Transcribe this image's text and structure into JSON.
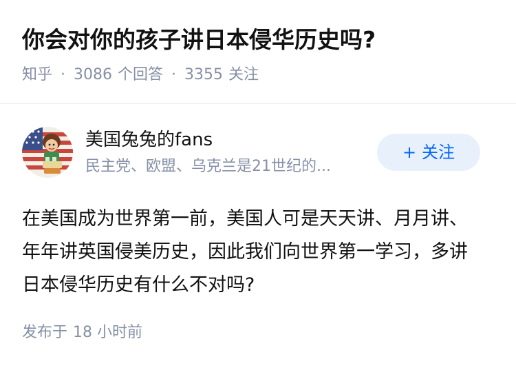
{
  "question": {
    "title": "你会对你的孩子讲日本侵华历史吗?",
    "source": "知乎",
    "answer_count": "3086",
    "answer_label": "个回答",
    "follower_count": "3355",
    "follower_label": "关注",
    "separator": "·"
  },
  "answer": {
    "author": {
      "name": "美国兔兔的fans",
      "bio": "民主党、欧盟、乌克兰是21世纪的...",
      "avatar_icon": "cartoon-character-avatar-icon"
    },
    "follow_button": {
      "plus": "+",
      "label": "关注"
    },
    "content": "在美国成为世界第一前，美国人可是天天讲、月月讲、年年讲英国侵美历史，因此我们向世界第一学习，多讲日本侵华历史有什么不对吗?",
    "published_label": "发布于",
    "published_time": "18 小时前"
  },
  "colors": {
    "text_primary": "#121212",
    "text_secondary": "#8590a6",
    "accent_blue": "#0066ff",
    "follow_bg": "#e8f1fb",
    "divider": "#ebebeb"
  }
}
